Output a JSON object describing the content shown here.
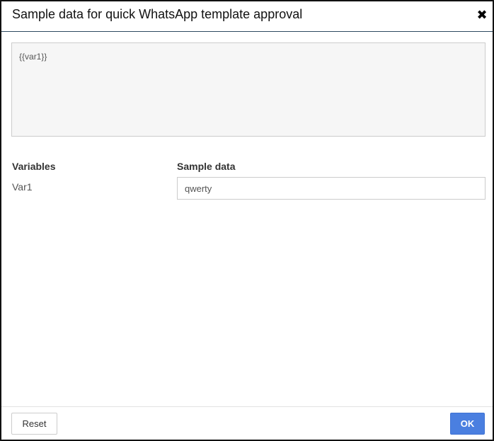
{
  "dialog": {
    "title": "Sample data for quick WhatsApp template approval",
    "close_icon": "close-icon",
    "close_glyph": "✖"
  },
  "template": {
    "body": "{{var1}}"
  },
  "variables_table": {
    "variables_header": "Variables",
    "sample_header": "Sample data",
    "rows": [
      {
        "variable": "Var1",
        "sample_value": "qwerty"
      }
    ]
  },
  "footer": {
    "reset_label": "Reset",
    "ok_label": "OK"
  },
  "colors": {
    "ok_button": "#4a7fe0",
    "preview_background": "#f6f6f6",
    "header_divider": "#2d4a60"
  }
}
